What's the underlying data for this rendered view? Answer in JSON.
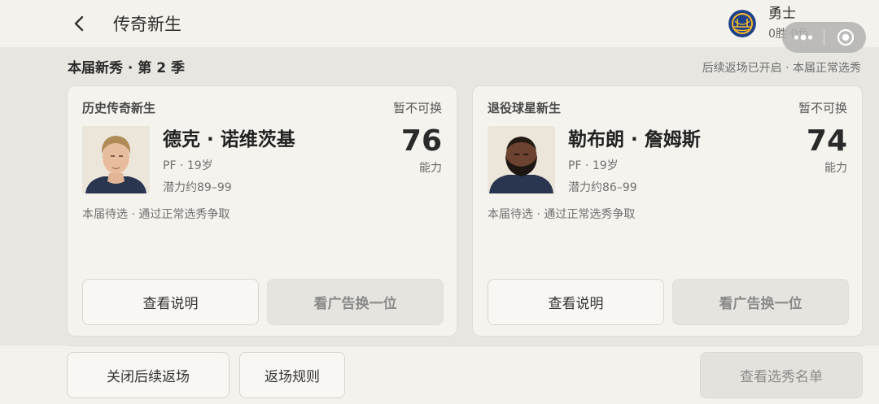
{
  "header": {
    "title": "传奇新生",
    "team_name": "勇士",
    "team_record": "0胜 0负"
  },
  "section": {
    "title": "本届新秀 · 第 2 季",
    "status": "后续返场已开启 · 本届正常选秀"
  },
  "cards": [
    {
      "category": "历史传奇新生",
      "lock_status": "暂不可换",
      "name": "德克 · 诺维茨基",
      "meta": "PF · 19岁",
      "potential": "潜力约89–99",
      "rating": "76",
      "rating_label": "能力",
      "draft_note": "本届待选 · 通过正常选秀争取",
      "view_label": "查看说明",
      "ad_label": "看广告换一位"
    },
    {
      "category": "退役球星新生",
      "lock_status": "暂不可换",
      "name": "勒布朗 · 詹姆斯",
      "meta": "PF · 19岁",
      "potential": "潜力约86–99",
      "rating": "74",
      "rating_label": "能力",
      "draft_note": "本届待选 · 通过正常选秀争取",
      "view_label": "查看说明",
      "ad_label": "看广告换一位"
    }
  ],
  "footer": {
    "close_label": "关闭后续返场",
    "rules_label": "返场规则",
    "list_label": "查看选秀名单"
  },
  "icons": {
    "back": "chevron-left-icon",
    "team_logo": "warriors-logo-icon",
    "more": "more-dots-icon",
    "close_miniapp": "target-circle-icon"
  },
  "colors": {
    "page_bg": "#e7e6e1",
    "card_bg": "#f5f3ee",
    "disabled_text": "#8a8a8a"
  }
}
